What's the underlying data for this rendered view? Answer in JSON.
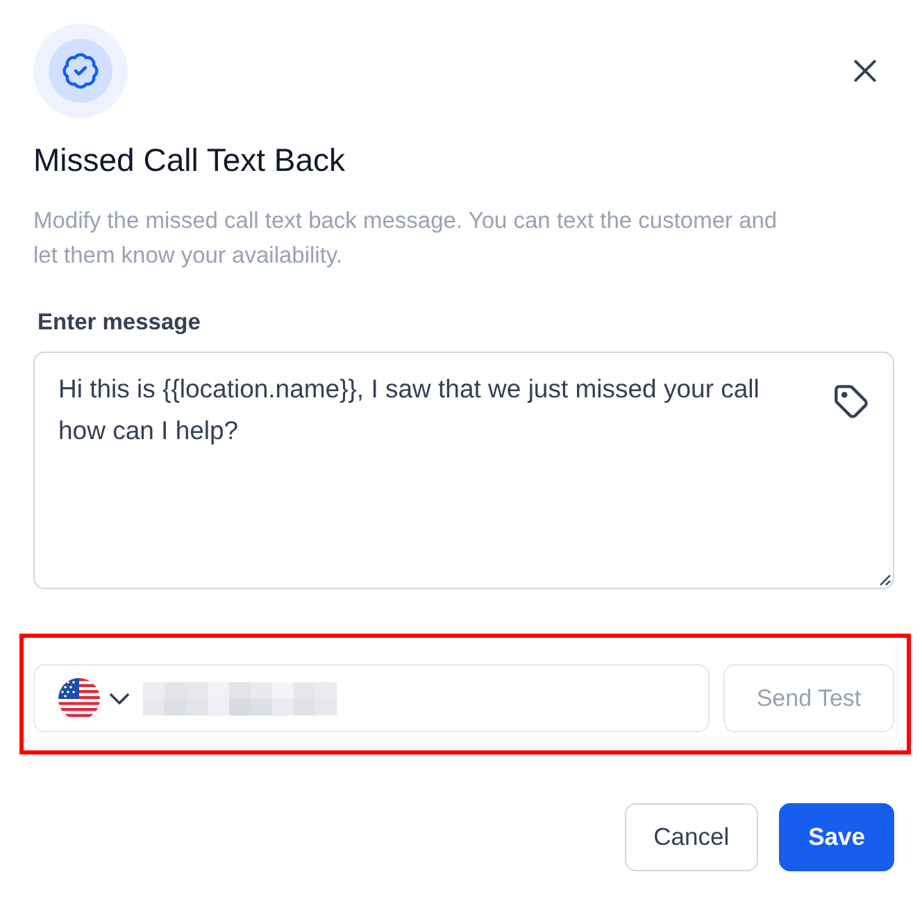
{
  "dialog": {
    "title": "Missed Call Text Back",
    "description": "Modify the missed call text back message. You can text the customer and let them know your availability.",
    "message_field": {
      "label": "Enter message",
      "value": "Hi this is {{location.name}}, I saw that we just missed your call how can I help?"
    },
    "test_section": {
      "highlighted": true,
      "phone": {
        "redacted": true
      },
      "send_test": {
        "label": "Send Test",
        "disabled": true
      }
    },
    "actions": [
      {
        "label": "Cancel",
        "kind": "secondary"
      },
      {
        "label": "Save",
        "kind": "primary"
      }
    ]
  }
}
